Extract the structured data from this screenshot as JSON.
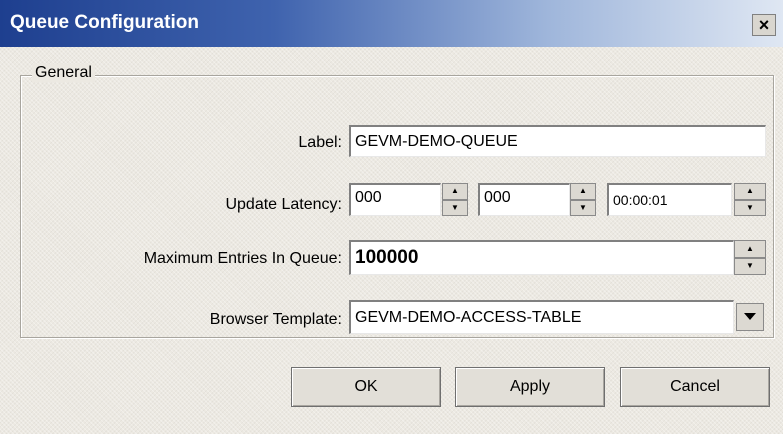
{
  "window": {
    "title": "Queue Configuration",
    "close_label": "×"
  },
  "group": {
    "title": "General"
  },
  "fields": {
    "label": {
      "caption": "Label:",
      "value": "GEVM-DEMO-QUEUE"
    },
    "update_latency": {
      "caption": "Update Latency:",
      "days": "000",
      "hours": "000",
      "time": "00:00:01"
    },
    "max_entries": {
      "caption": "Maximum Entries In Queue:",
      "value": "100000"
    },
    "browser_template": {
      "caption": "Browser Template:",
      "value": "GEVM-DEMO-ACCESS-TABLE"
    }
  },
  "buttons": {
    "ok": "OK",
    "apply": "Apply",
    "cancel": "Cancel"
  },
  "icons": {
    "spin_up": "spin-up-arrow",
    "spin_down": "spin-down-arrow",
    "dropdown": "chevron-down"
  },
  "colors": {
    "title_gradient_start": "#1e3f8f",
    "title_gradient_end": "#dfe7f3",
    "dialog_bg": "#ece9e2"
  }
}
